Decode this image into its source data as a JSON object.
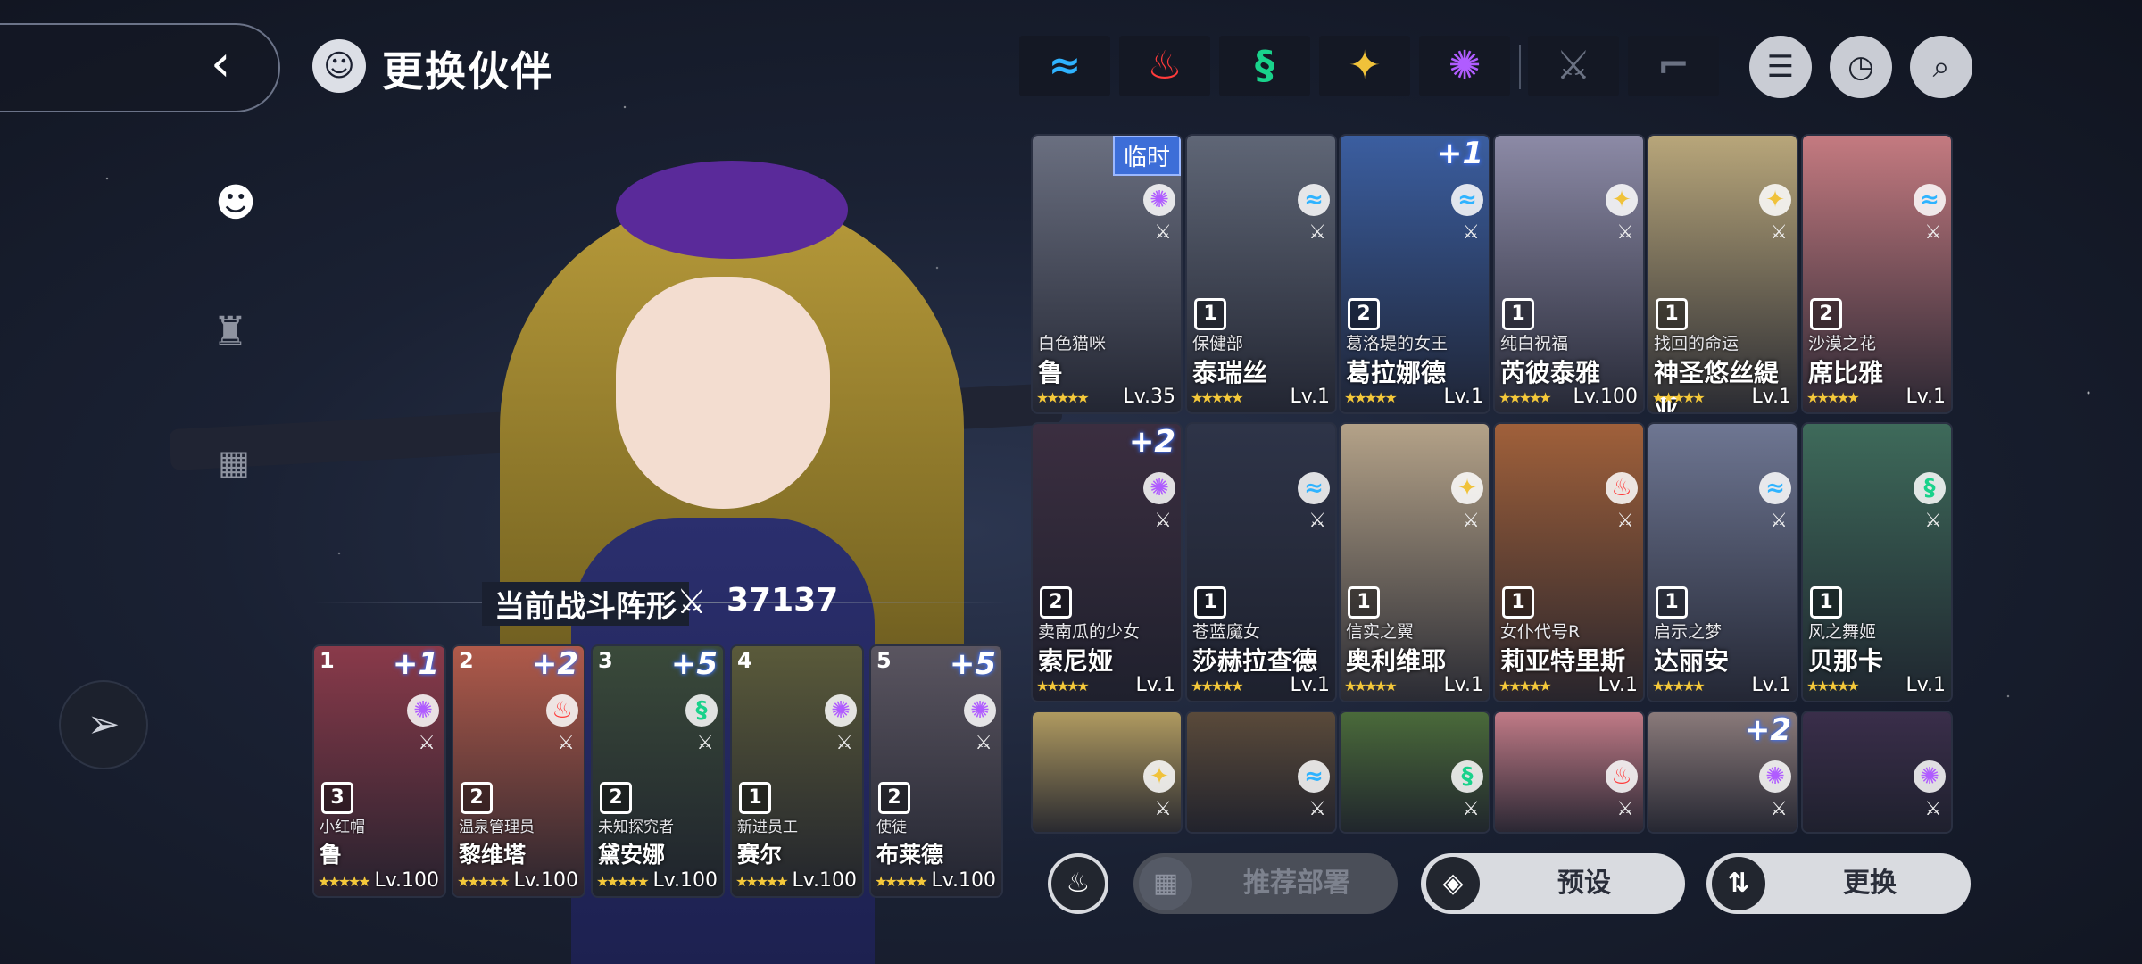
{
  "header": {
    "title": "更换伙伴",
    "back_icon": "chevron-left-icon"
  },
  "formation": {
    "label": "当前战斗阵形",
    "power": "37137"
  },
  "filters": [
    {
      "icon": "water-element-icon",
      "glyph": "≈",
      "color": "#2fb3ff"
    },
    {
      "icon": "fire-element-icon",
      "glyph": "♨",
      "color": "#ff3b3b"
    },
    {
      "icon": "wind-element-icon",
      "glyph": "§",
      "color": "#19d28b"
    },
    {
      "icon": "light-element-icon",
      "glyph": "✦",
      "color": "#f0c23a"
    },
    {
      "icon": "dark-element-icon",
      "glyph": "✺",
      "color": "#b05cff"
    },
    {
      "icon": "sword-icon",
      "glyph": "⚔",
      "color": "#6b7283"
    },
    {
      "icon": "gun-icon",
      "glyph": "⌐",
      "color": "#6b7283"
    }
  ],
  "team": [
    {
      "slot": "1",
      "boost": "+1",
      "elem": "✺",
      "elem_color": "#b05cff",
      "rank": "3",
      "title": "小红帽",
      "name": "鲁",
      "stars": "★★★★★",
      "level": "Lv.100",
      "bg": "#8a3a4a"
    },
    {
      "slot": "2",
      "boost": "+2",
      "elem": "♨",
      "elem_color": "#ff3b3b",
      "rank": "2",
      "title": "温泉管理员",
      "name": "黎维塔",
      "stars": "★★★★★",
      "level": "Lv.100",
      "bg": "#b05a4a"
    },
    {
      "slot": "3",
      "boost": "+5",
      "elem": "§",
      "elem_color": "#19d28b",
      "rank": "2",
      "title": "未知探究者",
      "name": "黛安娜",
      "stars": "★★★★★",
      "level": "Lv.100",
      "bg": "#3a4a3a"
    },
    {
      "slot": "4",
      "boost": "",
      "elem": "✺",
      "elem_color": "#b05cff",
      "rank": "1",
      "title": "新进员工",
      "name": "赛尔",
      "stars": "★★★★★",
      "level": "Lv.100",
      "bg": "#5a5a3a"
    },
    {
      "slot": "5",
      "boost": "+5",
      "elem": "✺",
      "elem_color": "#b05cff",
      "rank": "2",
      "title": "使徒",
      "name": "布莱德",
      "stars": "★★★★★",
      "level": "Lv.100",
      "bg": "#5a5560"
    }
  ],
  "roster_row1": [
    {
      "tag": "临时",
      "boost": "",
      "elem": "✺",
      "elem_color": "#b05cff",
      "rank": "",
      "title": "白色猫咪",
      "name": "鲁",
      "stars": "★★★★★",
      "level": "Lv.35",
      "bg": "#6a6f80"
    },
    {
      "tag": "",
      "boost": "",
      "elem": "≈",
      "elem_color": "#2fb3ff",
      "rank": "1",
      "title": "保健部",
      "name": "泰瑞丝",
      "stars": "★★★★★",
      "level": "Lv.1",
      "bg": "#5f6676"
    },
    {
      "tag": "",
      "boost": "+1",
      "elem": "≈",
      "elem_color": "#2fb3ff",
      "rank": "2",
      "title": "葛洛堤的女王",
      "name": "葛拉娜德",
      "stars": "★★★★★",
      "level": "Lv.1",
      "bg": "#3b5ea0"
    },
    {
      "tag": "",
      "boost": "",
      "elem": "✦",
      "elem_color": "#f0c23a",
      "rank": "1",
      "title": "纯白祝福",
      "name": "芮彼泰雅",
      "stars": "★★★★★",
      "level": "Lv.100",
      "bg": "#8c8aa6"
    },
    {
      "tag": "",
      "boost": "",
      "elem": "✦",
      "elem_color": "#f0c23a",
      "rank": "1",
      "title": "找回的命运",
      "name": "神圣悠丝緹亚",
      "stars": "★★★★★",
      "level": "Lv.1",
      "bg": "#b8a67a"
    },
    {
      "tag": "",
      "boost": "",
      "elem": "≈",
      "elem_color": "#2fb3ff",
      "rank": "2",
      "title": "沙漠之花",
      "name": "席比雅",
      "stars": "★★★★★",
      "level": "Lv.1",
      "bg": "#c47a80"
    }
  ],
  "roster_row2": [
    {
      "tag": "",
      "boost": "+2",
      "elem": "✺",
      "elem_color": "#b05cff",
      "rank": "2",
      "title": "卖南瓜的少女",
      "name": "索尼娅",
      "stars": "★★★★★",
      "level": "Lv.1",
      "bg": "#3b2e40"
    },
    {
      "tag": "",
      "boost": "",
      "elem": "≈",
      "elem_color": "#2fb3ff",
      "rank": "1",
      "title": "苍蓝魔女",
      "name": "莎赫拉查德",
      "stars": "★★★★★",
      "level": "Lv.1",
      "bg": "#2e3448"
    },
    {
      "tag": "",
      "boost": "",
      "elem": "✦",
      "elem_color": "#f0c23a",
      "rank": "1",
      "title": "信实之翼",
      "name": "奥利维耶",
      "stars": "★★★★★",
      "level": "Lv.1",
      "bg": "#b4a288"
    },
    {
      "tag": "",
      "boost": "",
      "elem": "♨",
      "elem_color": "#ff3b3b",
      "rank": "1",
      "title": "女仆代号R",
      "name": "莉亚特里斯",
      "stars": "★★★★★",
      "level": "Lv.1",
      "bg": "#a0603a"
    },
    {
      "tag": "",
      "boost": "",
      "elem": "≈",
      "elem_color": "#2fb3ff",
      "rank": "1",
      "title": "启示之梦",
      "name": "达丽安",
      "stars": "★★★★★",
      "level": "Lv.1",
      "bg": "#6e7692"
    },
    {
      "tag": "",
      "boost": "",
      "elem": "§",
      "elem_color": "#19d28b",
      "rank": "1",
      "title": "风之舞姬",
      "name": "贝那卡",
      "stars": "★★★★★",
      "level": "Lv.1",
      "bg": "#3e6a5a"
    }
  ],
  "roster_row3": [
    {
      "boost": "",
      "elem": "✦",
      "elem_color": "#f0c23a",
      "bg": "#b09a60"
    },
    {
      "boost": "",
      "elem": "≈",
      "elem_color": "#2fb3ff",
      "bg": "#5a4a3a"
    },
    {
      "boost": "",
      "elem": "§",
      "elem_color": "#19d28b",
      "bg": "#4a6a3a"
    },
    {
      "boost": "",
      "elem": "♨",
      "elem_color": "#ff3b3b",
      "bg": "#c07a86"
    },
    {
      "boost": "+2",
      "elem": "✺",
      "elem_color": "#b05cff",
      "bg": "#8a7a7a"
    },
    {
      "boost": "",
      "elem": "✺",
      "elem_color": "#b05cff",
      "bg": "#3a2e4a"
    }
  ],
  "actions": {
    "recommend": "推荐部署",
    "preset": "预设",
    "swap": "更换"
  }
}
